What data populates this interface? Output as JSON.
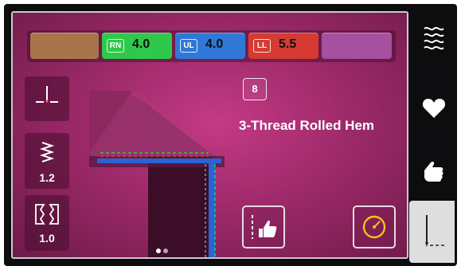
{
  "tension": {
    "slot1": {
      "color": "#a8744a"
    },
    "rn": {
      "code": "RN",
      "value": "4.0",
      "color": "#2ec94a"
    },
    "ul": {
      "code": "UL",
      "value": "4.0",
      "color": "#2f78d8"
    },
    "ll": {
      "code": "LL",
      "value": "5.5",
      "color": "#d63a32"
    },
    "slot5": {
      "color": "#a550a0"
    }
  },
  "left_panel": {
    "stitch_length": "1.2",
    "differential_feed": "1.0"
  },
  "program": {
    "number": "8",
    "name": "3-Thread Rolled Hem"
  },
  "pager": {
    "pages": 2,
    "active": 1
  },
  "icons": {
    "needle_position": "needle-position-icon",
    "stitch_length": "stitch-length-icon",
    "differential_feed": "differential-feed-icon",
    "sewing_tips": "sewing-tips-icon",
    "speed": "speed-icon",
    "stitch_menu": "stitch-menu-icon",
    "favorites": "heart-icon",
    "techniques": "hand-icon",
    "sewing_mode": "sewing-mode-icon"
  },
  "colors": {
    "background": "#9e2a6a",
    "thread_rn": "#2ec94a",
    "thread_ul": "#2f78d8",
    "thread_ll": "#d63a32",
    "speed_icon": "#f4c21a"
  }
}
